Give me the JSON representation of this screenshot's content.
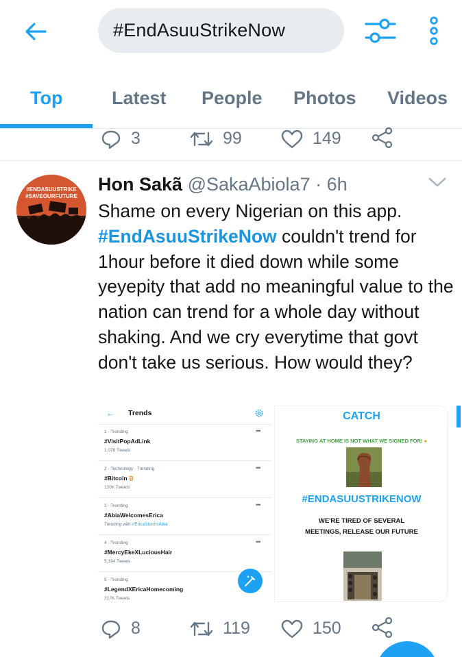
{
  "search": {
    "query": "#EndAsuuStrikeNow"
  },
  "tabs": [
    {
      "label": "Top",
      "active": true
    },
    {
      "label": "Latest",
      "active": false
    },
    {
      "label": "People",
      "active": false
    },
    {
      "label": "Photos",
      "active": false
    },
    {
      "label": "Videos",
      "active": false
    }
  ],
  "previous_tweet": {
    "replies": "3",
    "retweets": "99",
    "likes": "149"
  },
  "tweet": {
    "author_name": "Hon Sakã",
    "author_handle": "@SakaAbiola7",
    "time": "· 6h",
    "text_before": "Shame on every Nigerian on this app. ",
    "hashtag": "#EndAsuuStrikeNow",
    "text_after": " couldn't trend for 1hour before it died down while some yeyepity that add no meaningful value to the nation can trend for a whole day without shaking. And we cry everytime that govt don't take us serious. How would they?",
    "replies": "8",
    "retweets": "119",
    "likes": "150",
    "avatar_text": [
      "#ENDASUUSTRIKE",
      "#SAVEOURFUTURE"
    ]
  },
  "media_trends": {
    "title": "Trends",
    "items": [
      {
        "meta": "1 · Trending",
        "name": "#VisitPopAdLink",
        "count": "1,076 Tweets"
      },
      {
        "meta": "2 · Technology · Trending",
        "name": "#Bitcoin",
        "emoji": "₿",
        "count": "120K Tweets"
      },
      {
        "meta": "3 · Trending",
        "name": "#AbiaWelcomesErica",
        "count_prefix": "Trending with ",
        "count_link": "#EricaStormsAbia"
      },
      {
        "meta": "4 · Trending",
        "name": "#MercyEkeXLuciousHair",
        "count": "5,194 Tweets"
      },
      {
        "meta": "5 · Trending",
        "name": "#LegendXEricaHomecoming",
        "count": "317K Tweets"
      }
    ]
  },
  "media_poster": {
    "title": "CATCH",
    "subtitle": "STAYING AT HOME IS NOT WHAT WE SIGNED FOR!",
    "hashtag": "#ENDASUUSTRIKENOW",
    "body": "WE'RE TIRED OF SEVERAL MEETINGS, RELEASE OUR FUTURE"
  },
  "colors": {
    "accent": "#1da1f2",
    "text": "#14171a",
    "muted": "#657786",
    "green": "#3ba63b"
  },
  "icons": [
    "back-arrow-icon",
    "filter-sliders-icon",
    "more-vertical-icon",
    "reply-icon",
    "retweet-icon",
    "like-heart-icon",
    "share-icon",
    "chevron-down-icon",
    "compose-icon",
    "settings-gear-icon"
  ]
}
